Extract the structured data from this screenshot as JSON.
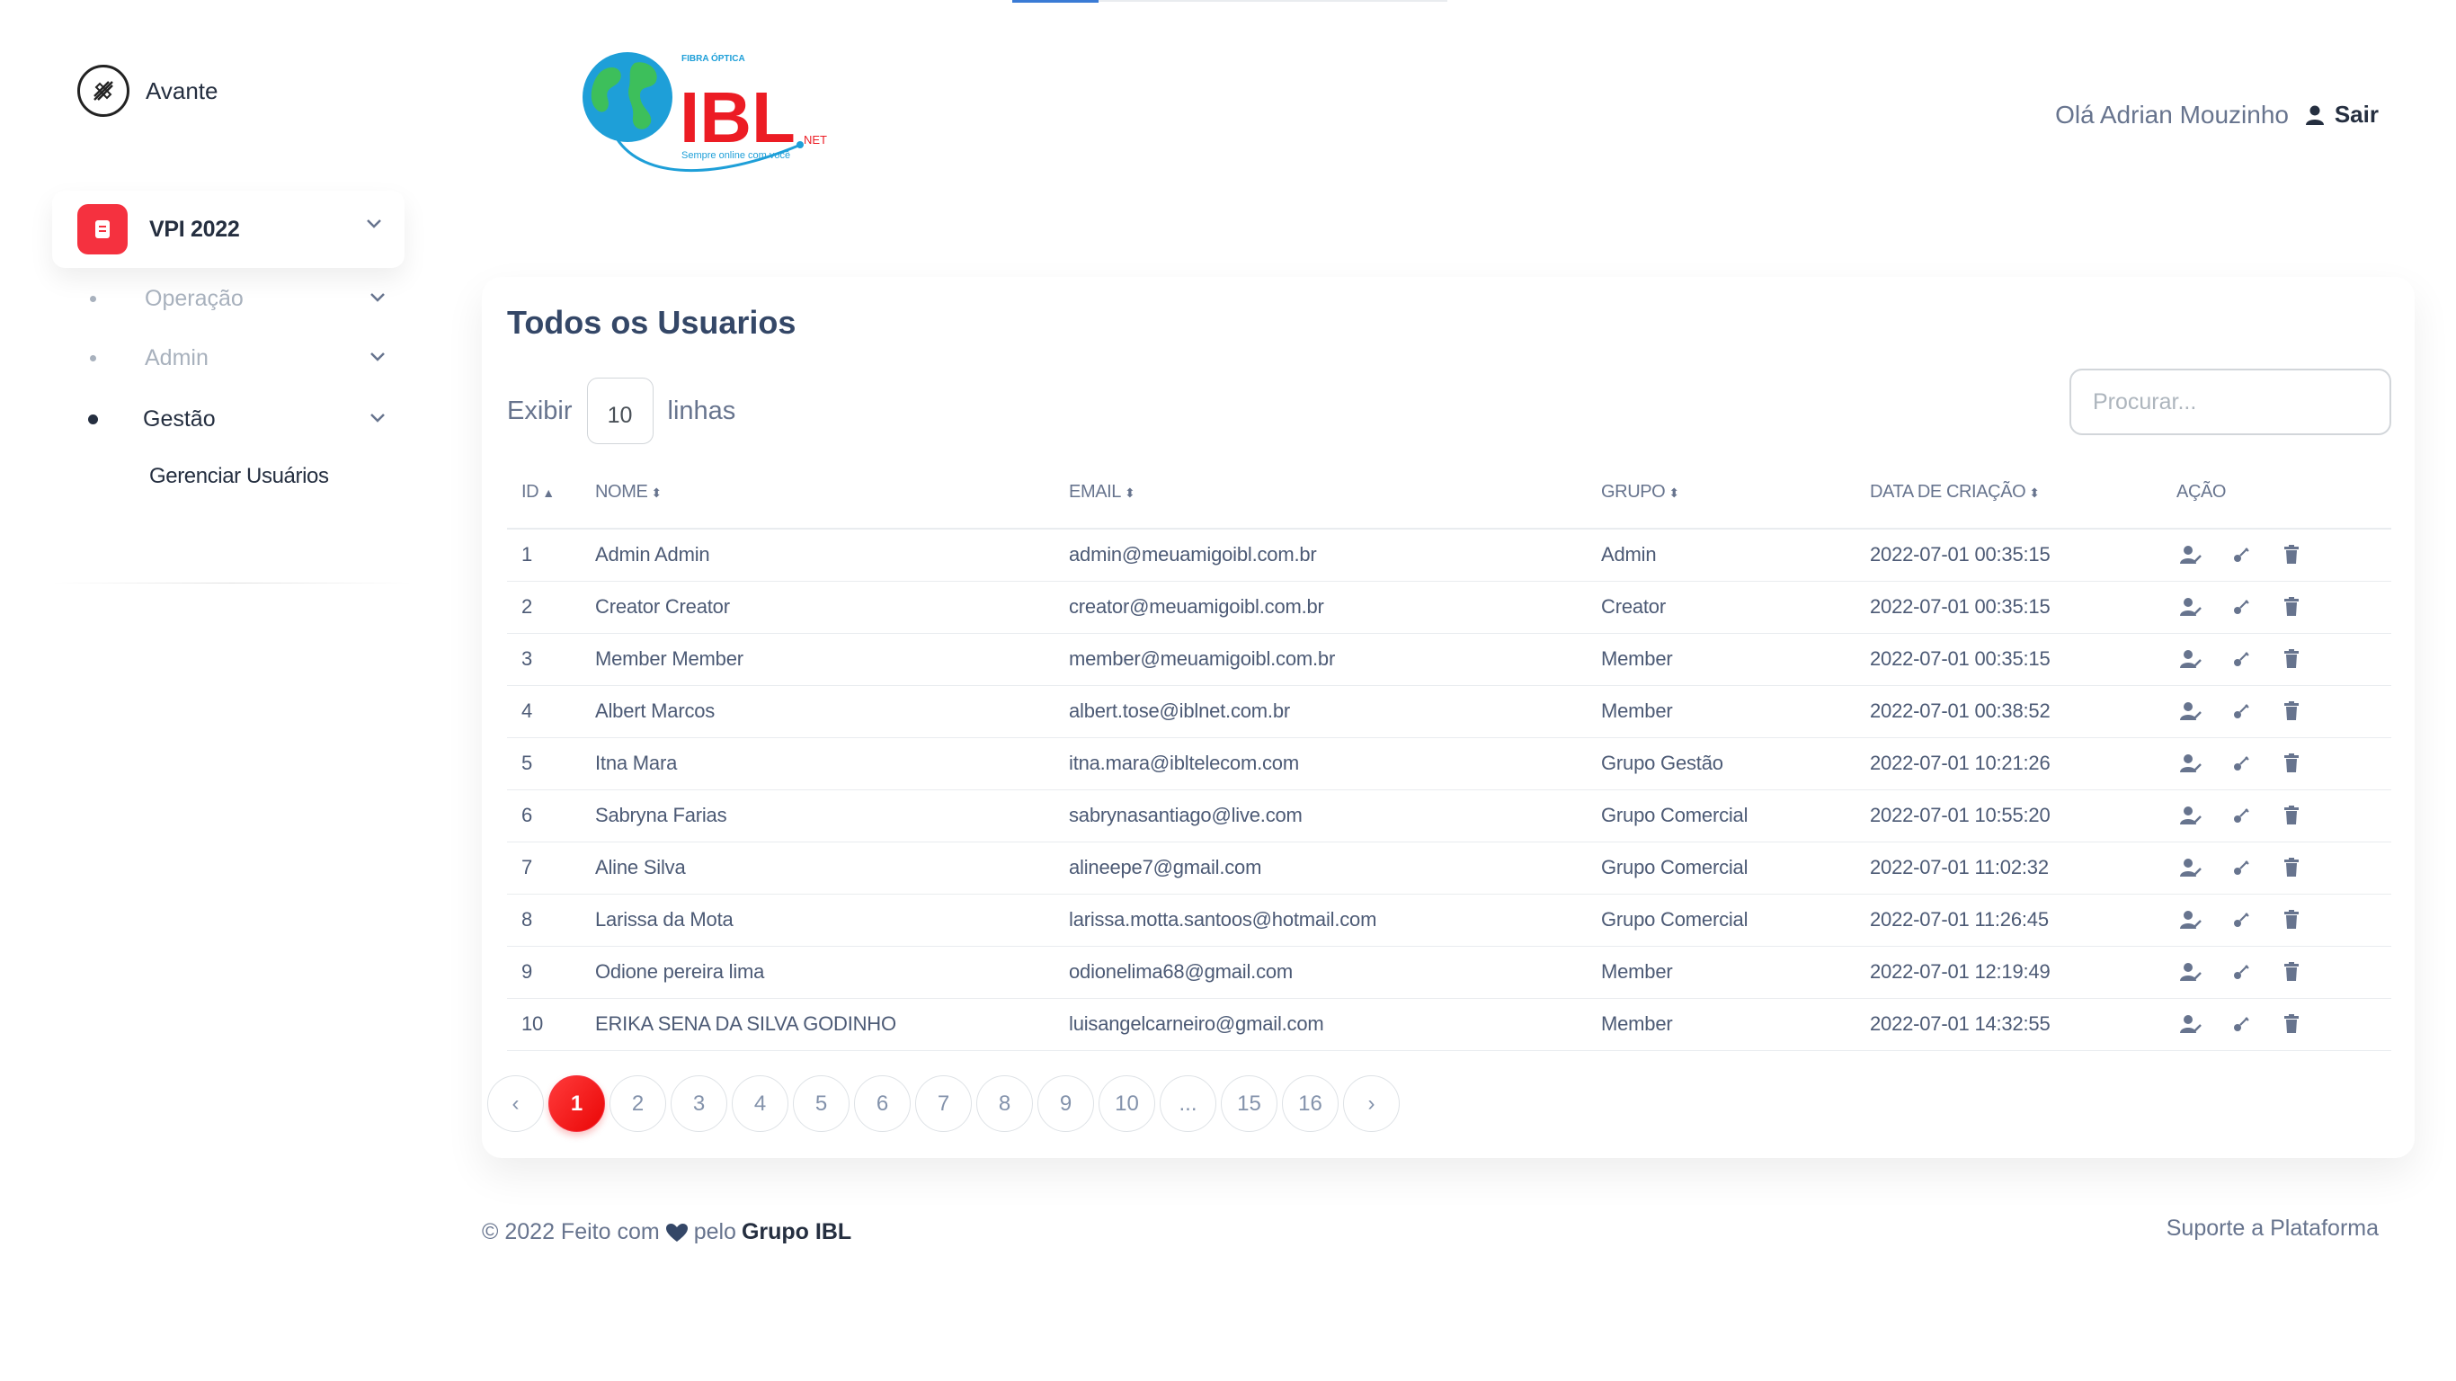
{
  "sidebar": {
    "brand": "Avante",
    "main_item": "VPI 2022",
    "items": [
      {
        "label": "Operação"
      },
      {
        "label": "Admin"
      },
      {
        "label": "Gestão"
      }
    ],
    "sub_link": "Gerenciar Usuários"
  },
  "header": {
    "logo": {
      "brand_text": "IBL",
      "net": "NET",
      "top_text": "FIBRA ÓPTICA",
      "slogan": "Sempre online com você"
    },
    "greeting": "Olá Adrian Mouzinho",
    "logout": "Sair"
  },
  "card": {
    "title": "Todos os Usuarios",
    "show_prefix": "Exibir",
    "show_value": "10",
    "show_suffix": "linhas",
    "search_placeholder": "Procurar..."
  },
  "table": {
    "headers": [
      "ID",
      "NOME",
      "EMAIL",
      "GRUPO",
      "DATA DE CRIAÇÃO",
      "AÇÃO"
    ],
    "rows": [
      [
        "1",
        "Admin Admin",
        "admin@meuamigoibl.com.br",
        "Admin",
        "2022-07-01 00:35:15"
      ],
      [
        "2",
        "Creator Creator",
        "creator@meuamigoibl.com.br",
        "Creator",
        "2022-07-01 00:35:15"
      ],
      [
        "3",
        "Member Member",
        "member@meuamigoibl.com.br",
        "Member",
        "2022-07-01 00:35:15"
      ],
      [
        "4",
        "Albert Marcos",
        "albert.tose@iblnet.com.br",
        "Member",
        "2022-07-01 00:38:52"
      ],
      [
        "5",
        "Itna Mara",
        "itna.mara@ibltelecom.com",
        "Grupo Gestão",
        "2022-07-01 10:21:26"
      ],
      [
        "6",
        "Sabryna Farias",
        "sabrynasantiago@live.com",
        "Grupo Comercial",
        "2022-07-01 10:55:20"
      ],
      [
        "7",
        "Aline Silva",
        "alineepe7@gmail.com",
        "Grupo Comercial",
        "2022-07-01 11:02:32"
      ],
      [
        "8",
        "Larissa da Mota",
        "larissa.motta.santoos@hotmail.com",
        "Grupo Comercial",
        "2022-07-01 11:26:45"
      ],
      [
        "9",
        "Odione pereira lima",
        "odionelima68@gmail.com",
        "Member",
        "2022-07-01 12:19:49"
      ],
      [
        "10",
        "ERIKA SENA DA SILVA GODINHO",
        "luisangelcarneiro@gmail.com",
        "Member",
        "2022-07-01 14:32:55"
      ]
    ]
  },
  "pagination": {
    "prev": "‹",
    "next": "›",
    "pages": [
      "1",
      "2",
      "3",
      "4",
      "5",
      "6",
      "7",
      "8",
      "9",
      "10",
      "...",
      "15",
      "16"
    ],
    "active": "1"
  },
  "footer": {
    "prefix": "© 2022 Feito com",
    "middle": "pelo",
    "brand": "Grupo IBL",
    "support": "Suporte a Plataforma"
  },
  "colors": {
    "accent": "#f5313f",
    "text": "#344767",
    "muted": "#67748e"
  }
}
